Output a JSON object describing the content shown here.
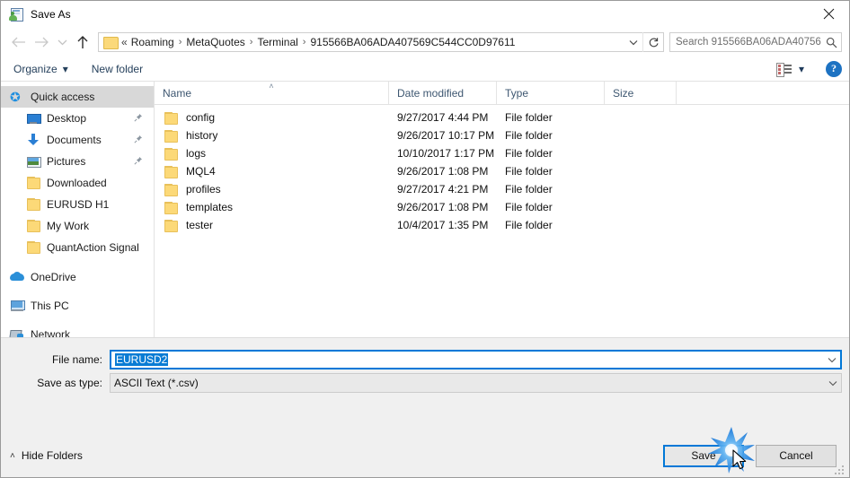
{
  "window": {
    "title": "Save As",
    "title_icon": "save-as-icon",
    "close_icon": "close-icon"
  },
  "nav": {
    "back_icon": "arrow-left-icon",
    "forward_icon": "arrow-right-icon",
    "recent_icon": "chevron-down-icon",
    "up_icon": "arrow-up-icon",
    "folder_icon": "folder-icon",
    "breadcrumb_prefix": "«",
    "breadcrumbs": [
      "Roaming",
      "MetaQuotes",
      "Terminal",
      "915566BA06ADA407569C544CC0D97611"
    ],
    "separator": "›",
    "dropdown_icon": "chevron-down-icon",
    "refresh_icon": "refresh-icon"
  },
  "search": {
    "placeholder": "Search 915566BA06ADA40756...",
    "icon": "search-icon"
  },
  "commandbar": {
    "organize": "Organize",
    "organize_caret": "▾",
    "new_folder": "New folder",
    "view_icon": "view-list-icon",
    "view_caret": "▾",
    "help_label": "?"
  },
  "sidebar": {
    "items": [
      {
        "label": "Quick access",
        "icon": "star-icon",
        "selected": true,
        "indent": false,
        "pinned": false
      },
      {
        "label": "Desktop",
        "icon": "desktop-icon",
        "selected": false,
        "indent": true,
        "pinned": true
      },
      {
        "label": "Documents",
        "icon": "downloads-arrow-icon",
        "selected": false,
        "indent": true,
        "pinned": true
      },
      {
        "label": "Pictures",
        "icon": "pictures-icon",
        "selected": false,
        "indent": true,
        "pinned": true
      },
      {
        "label": "Downloaded",
        "icon": "folder-icon",
        "selected": false,
        "indent": true,
        "pinned": false
      },
      {
        "label": "EURUSD H1",
        "icon": "folder-icon",
        "selected": false,
        "indent": true,
        "pinned": false
      },
      {
        "label": "My Work",
        "icon": "folder-icon",
        "selected": false,
        "indent": true,
        "pinned": false
      },
      {
        "label": "QuantAction Signal",
        "icon": "folder-icon",
        "selected": false,
        "indent": true,
        "pinned": false
      },
      {
        "label": "OneDrive",
        "icon": "cloud-icon",
        "selected": false,
        "indent": false,
        "pinned": false
      },
      {
        "label": "This PC",
        "icon": "computer-icon",
        "selected": false,
        "indent": false,
        "pinned": false
      },
      {
        "label": "Network",
        "icon": "network-icon",
        "selected": false,
        "indent": false,
        "pinned": false
      }
    ]
  },
  "filelist": {
    "columns": [
      "Name",
      "Date modified",
      "Type",
      "Size"
    ],
    "sort_column": "Name",
    "sort_caret": "˄",
    "rows": [
      {
        "name": "config",
        "date": "9/27/2017 4:44 PM",
        "type": "File folder",
        "size": ""
      },
      {
        "name": "history",
        "date": "9/26/2017 10:17 PM",
        "type": "File folder",
        "size": ""
      },
      {
        "name": "logs",
        "date": "10/10/2017 1:17 PM",
        "type": "File folder",
        "size": ""
      },
      {
        "name": "MQL4",
        "date": "9/26/2017 1:08 PM",
        "type": "File folder",
        "size": ""
      },
      {
        "name": "profiles",
        "date": "9/27/2017 4:21 PM",
        "type": "File folder",
        "size": ""
      },
      {
        "name": "templates",
        "date": "9/26/2017 1:08 PM",
        "type": "File folder",
        "size": ""
      },
      {
        "name": "tester",
        "date": "10/4/2017 1:35 PM",
        "type": "File folder",
        "size": ""
      }
    ]
  },
  "form": {
    "filename_label": "File name:",
    "filename_value": "EURUSD2",
    "filetype_label": "Save as type:",
    "filetype_value": "ASCII Text (*.csv)",
    "caret": "⌄"
  },
  "footer": {
    "hide_folders": "Hide Folders",
    "hide_caret": "˄",
    "save_label": "Save",
    "cancel_label": "Cancel"
  },
  "pointer": {
    "click_effect": "click-burst",
    "cursor": "arrow-cursor"
  },
  "colors": {
    "accent": "#0078d7",
    "selection": "#0a7cd4",
    "folder": "#fcd978",
    "sidebar_selected": "#d8d8d8",
    "chrome": "#f0f0f0"
  }
}
